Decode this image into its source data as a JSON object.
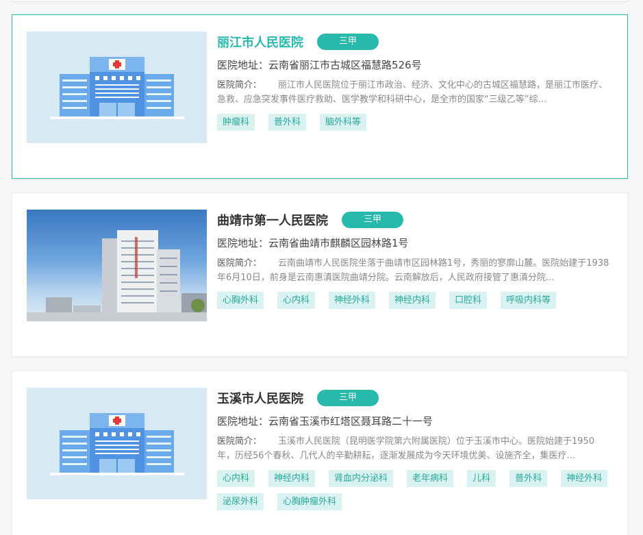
{
  "hospitals": [
    {
      "name": "丽江市人民医院",
      "level": "三甲",
      "address": "医院地址：云南省丽江市古城区福慧路526号",
      "intro_label": "医院简介：",
      "intro": "丽江市人民医院位于丽江市政治、经济、文化中心的古城区福慧路，是丽江市医疗、急救、应急突发事件医疗救助、医学教学和科研中心，是全市的国家“三级乙等”综…",
      "tags": [
        "肿瘤科",
        "普外科",
        "脑外科等"
      ]
    },
    {
      "name": "曲靖市第一人民医院",
      "level": "三甲",
      "address": "医院地址：云南省曲靖市麒麟区园林路1号",
      "intro_label": "医院简介：",
      "intro": "云南曲靖市人民医院坐落于曲靖市区园林路1号，秀丽的寥廓山麓。医院始建于1938年6月10日，前身是云南惠滇医院曲靖分院。云南解放后，人民政府接管了惠滇分院…",
      "tags": [
        "心胸外科",
        "心内科",
        "神经外科",
        "神经内科",
        "口腔科",
        "呼吸内科等"
      ]
    },
    {
      "name": "玉溪市人民医院",
      "level": "三甲",
      "address": "医院地址：云南省玉溪市红塔区聂耳路二十一号",
      "intro_label": "医院简介：",
      "intro": "玉溪市人民医院（昆明医学院第六附属医院）位于玉溪市中心。医院始建于1950年，历经56个春秋、几代人的辛勤耕耘，逐渐发展成为今天环境优美、设施齐全，集医疗…",
      "tags": [
        "心内科",
        "神经内科",
        "肾血内分泌科",
        "老年病科",
        "儿科",
        "普外科",
        "神经外科",
        "泌尿外科",
        "心胸肿瘤外科"
      ]
    }
  ],
  "colors": {
    "accent": "#27b9ab",
    "tag_bg": "#daf2f1"
  }
}
